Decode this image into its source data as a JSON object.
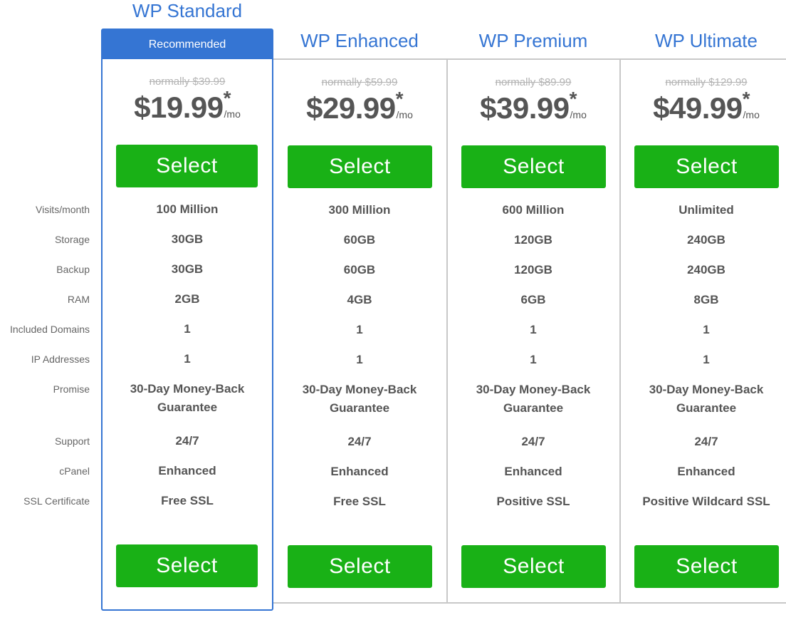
{
  "row_labels": [
    "Visits/month",
    "Storage",
    "Backup",
    "RAM",
    "Included Domains",
    "IP Addresses",
    "Promise",
    "Support",
    "cPanel",
    "SSL Certificate"
  ],
  "plans": [
    {
      "name": "WP Standard",
      "badge": "Recommended",
      "normal_price": "normally $39.99",
      "price": "$19.99",
      "asterisk": "*",
      "per": "/mo",
      "select_label": "Select",
      "features": [
        "100 Million",
        "30GB",
        "30GB",
        "2GB",
        "1",
        "1",
        "30-Day Money-Back Guarantee",
        "24/7",
        "Enhanced",
        "Free SSL"
      ]
    },
    {
      "name": "WP Enhanced",
      "normal_price": "normally $59.99",
      "price": "$29.99",
      "asterisk": "*",
      "per": "/mo",
      "select_label": "Select",
      "features": [
        "300 Million",
        "60GB",
        "60GB",
        "4GB",
        "1",
        "1",
        "30-Day Money-Back Guarantee",
        "24/7",
        "Enhanced",
        "Free SSL"
      ]
    },
    {
      "name": "WP Premium",
      "normal_price": "normally $89.99",
      "price": "$39.99",
      "asterisk": "*",
      "per": "/mo",
      "select_label": "Select",
      "features": [
        "600 Million",
        "120GB",
        "120GB",
        "6GB",
        "1",
        "1",
        "30-Day Money-Back Guarantee",
        "24/7",
        "Enhanced",
        "Positive SSL"
      ]
    },
    {
      "name": "WP Ultimate",
      "normal_price": "normally $129.99",
      "price": "$49.99",
      "asterisk": "*",
      "per": "/mo",
      "select_label": "Select",
      "features": [
        "Unlimited",
        "240GB",
        "240GB",
        "8GB",
        "1",
        "1",
        "30-Day Money-Back Guarantee",
        "24/7",
        "Enhanced",
        "Positive Wildcard SSL"
      ]
    }
  ],
  "colors": {
    "accent": "#3575d3",
    "button": "#19b116",
    "border": "#c8c8c8"
  }
}
